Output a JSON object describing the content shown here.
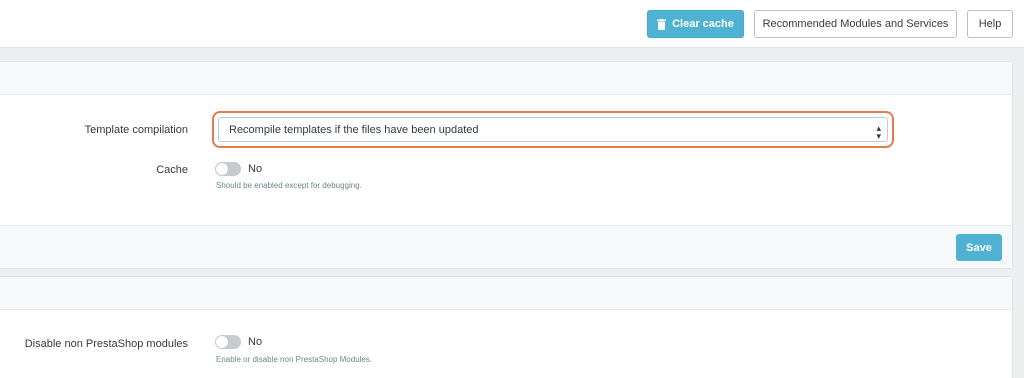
{
  "toolbar": {
    "clear_cache_label": "Clear cache",
    "recommended_label": "Recommended Modules and Services",
    "help_label": "Help"
  },
  "smarty": {
    "template_compilation_label": "Template compilation",
    "template_compilation_value": "Recompile templates if the files have been updated",
    "cache_label": "Cache",
    "cache_value": "No",
    "cache_help": "Should be enabled except for debugging.",
    "save_label": "Save"
  },
  "debug": {
    "disable_modules_label": "Disable non PrestaShop modules",
    "disable_modules_value": "No",
    "disable_modules_help": "Enable or disable non PrestaShop Modules."
  },
  "colors": {
    "accent": "#4fb2d3",
    "highlight": "#e27c4f",
    "switch_off": "#c5cbd0"
  }
}
